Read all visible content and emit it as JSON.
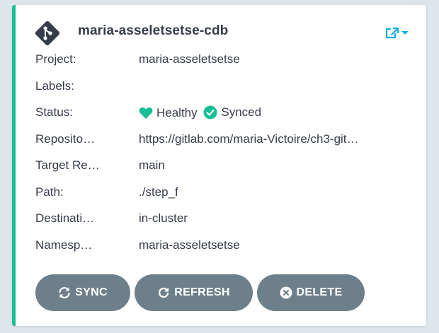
{
  "app": {
    "name": "maria-asseletsetse-cdb"
  },
  "fields": {
    "project_label": "Project:",
    "project_value": "maria-asseletsetse",
    "labels_label": "Labels:",
    "labels_value": "",
    "status_label": "Status:",
    "health_status": "Healthy",
    "sync_status": "Synced",
    "repository_label": "Reposito…",
    "repository_value": "https://gitlab.com/maria-Victoire/ch3-git…",
    "target_label": "Target Re…",
    "target_value": "main",
    "path_label": "Path:",
    "path_value": "./step_f",
    "destination_label": "Destinati…",
    "destination_value": "in-cluster",
    "namespace_label": "Namesp…",
    "namespace_value": "maria-asseletsetse"
  },
  "actions": {
    "sync_label": "SYNC",
    "refresh_label": "REFRESH",
    "delete_label": "DELETE"
  },
  "colors": {
    "accent": "#18be94",
    "link": "#0dadea",
    "button": "#6d7f8b",
    "text": "#363c4a",
    "background": "#dee6eb"
  },
  "icons": {
    "app": "git-diamond-icon",
    "external": "external-link-icon",
    "dropdown": "caret-down-icon",
    "health": "heart-icon",
    "sync": "check-circle-icon",
    "sync_button": "sync-arrows-icon",
    "refresh_button": "refresh-icon",
    "delete_button": "times-circle-icon"
  }
}
